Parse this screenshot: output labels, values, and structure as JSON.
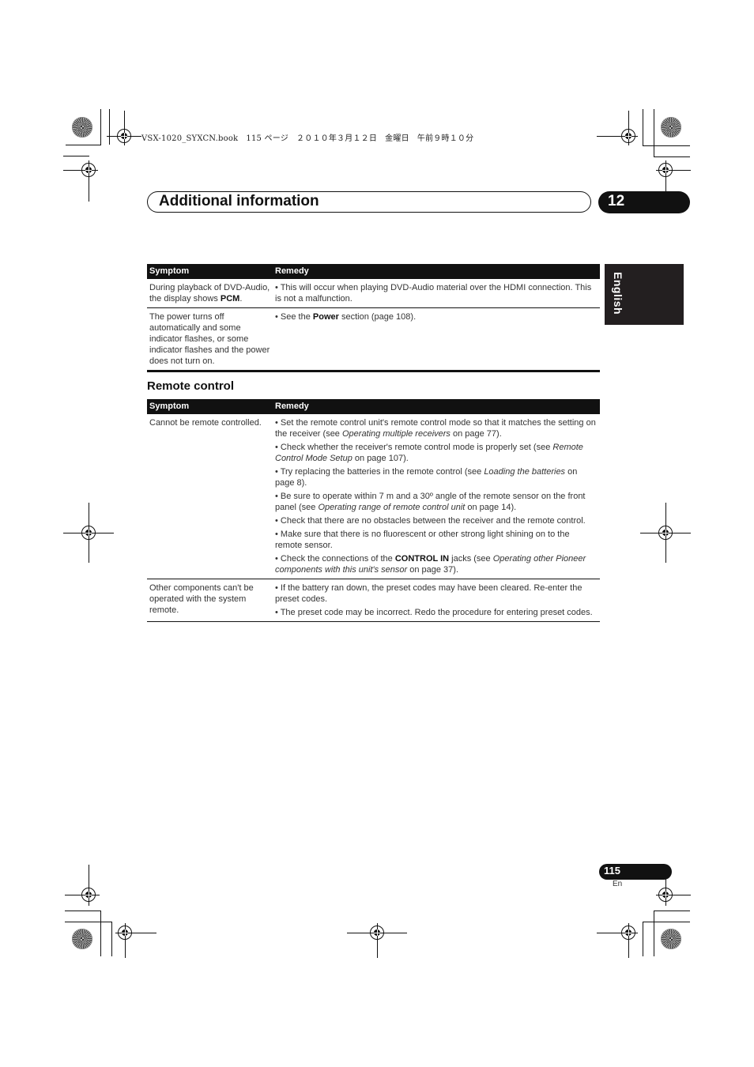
{
  "print_header": {
    "text": "VSX-1020_SYXCN.book   115 ページ   ２０１０年３月１２日   金曜日   午前９時１０分"
  },
  "header": {
    "title": "Additional information",
    "chapter": "12"
  },
  "language_tab": "English",
  "table1": {
    "columns": [
      "Symptom",
      "Remedy"
    ],
    "rows": [
      {
        "symptom_parts": [
          "During playback of DVD-Audio, the display shows ",
          "PCM",
          "."
        ],
        "remedies": [
          {
            "parts": [
              {
                "t": "• This will occur when playing DVD-Audio material over the HDMI connection. This is not a malfunction.",
                "s": "n"
              }
            ]
          }
        ]
      },
      {
        "symptom_parts": [
          "The power turns off automatically and some indicator flashes, or some indicator flashes and the power does not turn on.",
          "",
          ""
        ],
        "remedies": [
          {
            "parts": [
              {
                "t": "• See the ",
                "s": "n"
              },
              {
                "t": "Power",
                "s": "b"
              },
              {
                "t": " section (page 108).",
                "s": "n"
              }
            ]
          }
        ]
      }
    ]
  },
  "section2": {
    "heading": "Remote control",
    "columns": [
      "Symptom",
      "Remedy"
    ],
    "rows": [
      {
        "symptom": "Cannot be remote controlled.",
        "remedies": [
          {
            "parts": [
              {
                "t": "• Set the remote control unit's remote control mode so that it matches the setting on the receiver (see ",
                "s": "n"
              },
              {
                "t": "Operating multiple receivers",
                "s": "i"
              },
              {
                "t": " on page 77).",
                "s": "n"
              }
            ]
          },
          {
            "parts": [
              {
                "t": "• Check whether the receiver's remote control mode is properly set (see ",
                "s": "n"
              },
              {
                "t": "Remote Control Mode Setup",
                "s": "i"
              },
              {
                "t": " on page 107).",
                "s": "n"
              }
            ]
          },
          {
            "parts": [
              {
                "t": "• Try replacing the batteries in the remote control (see ",
                "s": "n"
              },
              {
                "t": "Loading the batteries",
                "s": "i"
              },
              {
                "t": " on page 8).",
                "s": "n"
              }
            ]
          },
          {
            "parts": [
              {
                "t": "• Be sure to operate within 7 m and a 30º angle of the remote sensor on the front panel (see ",
                "s": "n"
              },
              {
                "t": "Operating range of remote control unit",
                "s": "i"
              },
              {
                "t": " on page 14).",
                "s": "n"
              }
            ]
          },
          {
            "parts": [
              {
                "t": "• Check that there are no obstacles between the receiver and the remote control.",
                "s": "n"
              }
            ]
          },
          {
            "parts": [
              {
                "t": "• Make sure that there is no fluorescent or other strong light shining on to the remote sensor.",
                "s": "n"
              }
            ]
          },
          {
            "parts": [
              {
                "t": "• Check the connections of the ",
                "s": "n"
              },
              {
                "t": "CONTROL IN",
                "s": "b"
              },
              {
                "t": " jacks (see ",
                "s": "n"
              },
              {
                "t": "Operating other Pioneer components with this unit's sensor",
                "s": "i"
              },
              {
                "t": " on page 37).",
                "s": "n"
              }
            ]
          }
        ]
      },
      {
        "symptom": "Other components can't be operated with the system remote.",
        "remedies": [
          {
            "parts": [
              {
                "t": "• If the battery ran down, the preset codes may have been cleared. Re-enter the preset codes.",
                "s": "n"
              }
            ]
          },
          {
            "parts": [
              {
                "t": "• The preset code may be incorrect. Redo the procedure for entering preset codes.",
                "s": "n"
              }
            ]
          }
        ]
      }
    ]
  },
  "footer": {
    "page_number": "115",
    "lang_code": "En"
  }
}
